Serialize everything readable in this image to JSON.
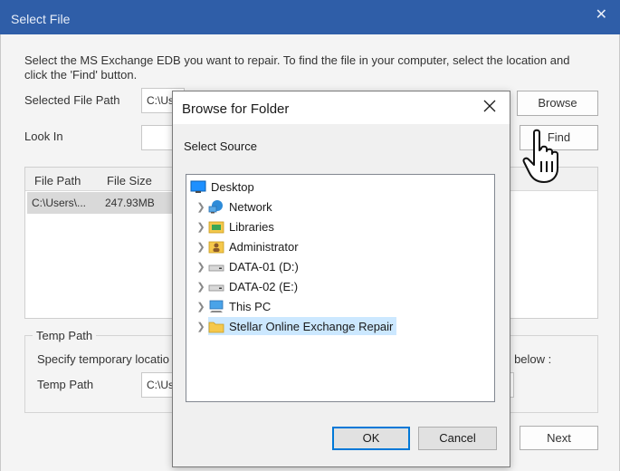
{
  "main": {
    "title": "Select File",
    "intro": "Select the MS Exchange EDB you want to repair. To find the file in your computer, select the location and click the 'Find' button.",
    "selected_file_path_label": "Selected File Path",
    "selected_file_path_value": "C:\\Us",
    "look_in_label": "Look In",
    "browse_label": "Browse",
    "find_label": "Find",
    "table": {
      "columns": [
        "File Path",
        "File Size"
      ],
      "rows": [
        {
          "path": "C:\\Users\\...",
          "size": "247.93MB"
        }
      ]
    },
    "temp": {
      "group_label": "Temp Path",
      "specify_left": "Specify temporary locatio",
      "specify_right": "ed below :",
      "temp_path_label": "Temp Path",
      "temp_path_value": "C:\\Us"
    },
    "next_label": "Next"
  },
  "dialog": {
    "title": "Browse for Folder",
    "subtitle": "Select Source",
    "tree": [
      {
        "label": "Desktop",
        "icon": "desktop-icon"
      },
      {
        "label": "Network",
        "icon": "network-icon"
      },
      {
        "label": "Libraries",
        "icon": "libraries-icon"
      },
      {
        "label": "Administrator",
        "icon": "user-folder-icon"
      },
      {
        "label": "DATA-01 (D:)",
        "icon": "drive-icon"
      },
      {
        "label": "DATA-02 (E:)",
        "icon": "drive-icon"
      },
      {
        "label": "This PC",
        "icon": "computer-icon"
      },
      {
        "label": "Stellar Online Exchange Repair",
        "icon": "folder-icon",
        "selected": true
      }
    ],
    "ok_label": "OK",
    "cancel_label": "Cancel"
  },
  "colors": {
    "titlebar": "#2f5ea8",
    "selection": "#cce8ff",
    "default_button_border": "#0078d7"
  }
}
